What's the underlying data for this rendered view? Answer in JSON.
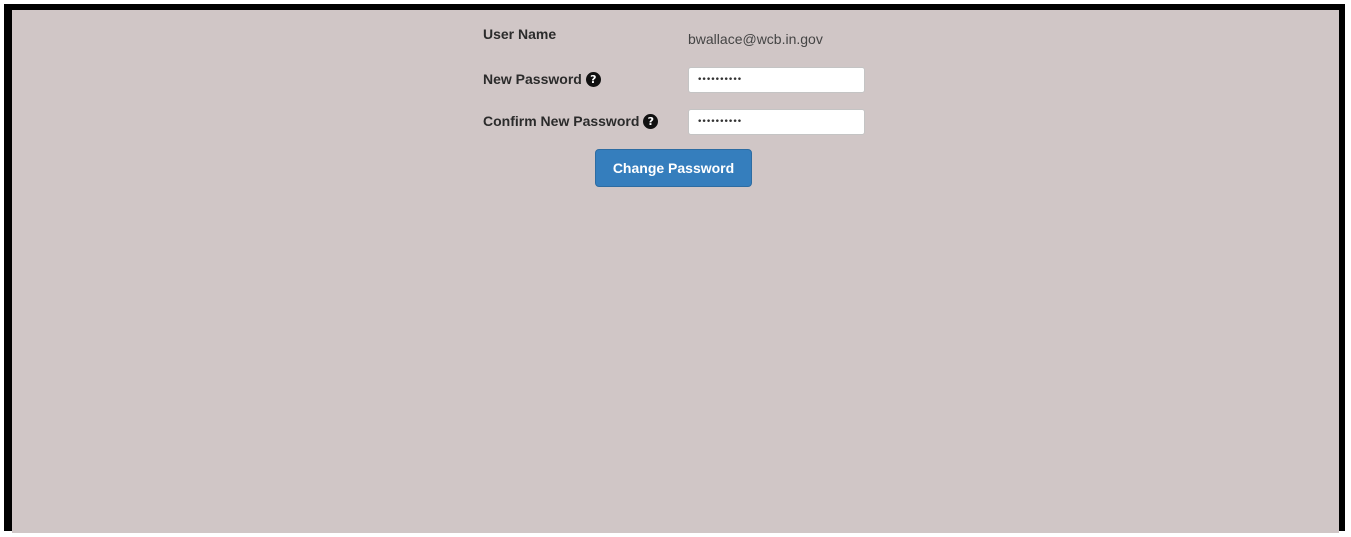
{
  "form": {
    "username_label": "User Name",
    "username_value": "bwallace@wcb.in.gov",
    "new_password_label": "New Password",
    "new_password_value": "••••••••••",
    "confirm_password_label": "Confirm New Password",
    "confirm_password_value": "••••••••••",
    "help_icon_glyph": "?",
    "submit_label": "Change Password"
  },
  "colors": {
    "background": "#d0c6c6",
    "frame": "#000000",
    "button": "#357ebd",
    "button_text": "#ffffff"
  }
}
